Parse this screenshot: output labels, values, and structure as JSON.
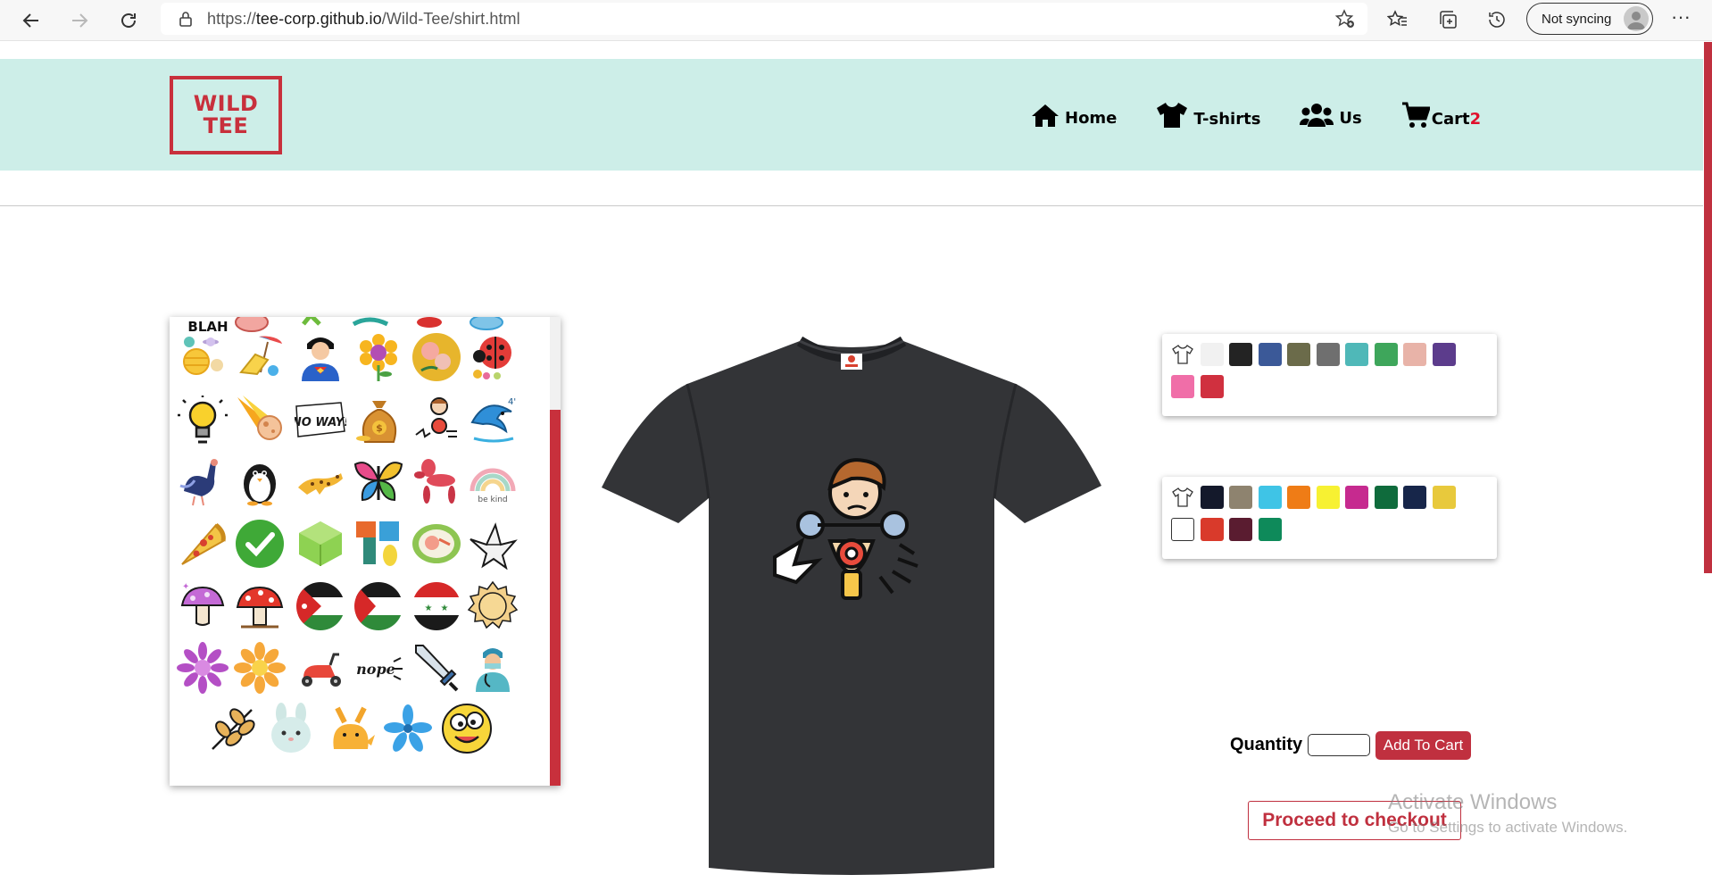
{
  "browser": {
    "url_prefix": "https://",
    "url_host": "tee-corp.github.io",
    "url_path": "/Wild-Tee/shirt.html",
    "sync_label": "Not syncing"
  },
  "header": {
    "logo_line1": "WILD",
    "logo_line2": "TEE",
    "nav": {
      "home": "Home",
      "tshirts": "T-shirts",
      "us": "Us",
      "cart": "Cart",
      "cart_count": "2"
    }
  },
  "stickers": {
    "top_partial_text": "BLAH",
    "noway_text": "NO WAY!",
    "nope_text": "nope",
    "bekind_text": "be kind",
    "items": [
      "planets",
      "beach-chair",
      "superman",
      "sunflower",
      "flower-badge",
      "ladybug",
      "lightbulb",
      "meteor",
      "no-way-text",
      "money-bag",
      "scooter-kid",
      "dolphin",
      "ostrich",
      "penguin",
      "leopard",
      "butterfly",
      "balloon-dog",
      "rainbow",
      "pizza",
      "checkmark",
      "green-cube",
      "abstract-shapes",
      "sunny-egg",
      "origami-crane",
      "purple-mushroom",
      "red-mushroom",
      "jordan-flag",
      "palestine-flag",
      "syria-flag",
      "sun-badge",
      "purple-flower",
      "orange-flower",
      "red-scooter",
      "nope-text",
      "sword",
      "doctor",
      "branch",
      "bunny",
      "pikachu-fox",
      "blue-splash",
      "goofy-face"
    ]
  },
  "shirt_colors": [
    "#ffffff",
    "#f1f1f1",
    "#232323",
    "#3b5998",
    "#6b6b4a",
    "#6f6f6f",
    "#4fb8b8",
    "#3ea65b",
    "#e8b3a8",
    "#5c3c8c",
    "#f06ea8",
    "#d0303f"
  ],
  "print_colors": [
    "#ffffff",
    "#14192b",
    "#8e836f",
    "#3fc4e6",
    "#ef7c16",
    "#f7f132",
    "#c62a8f",
    "#0f6b3c",
    "#17264a",
    "#e8c93c",
    "#ffffff",
    "#d93a2b",
    "#5a1c30",
    "#0e8a5a"
  ],
  "purchase": {
    "quantity_label": "Quantity",
    "quantity_value": "",
    "add_to_cart": "Add To Cart",
    "checkout": "Proceed to checkout"
  },
  "watermark": {
    "title": "Activate Windows",
    "subtitle": "Go to Settings to activate Windows."
  }
}
